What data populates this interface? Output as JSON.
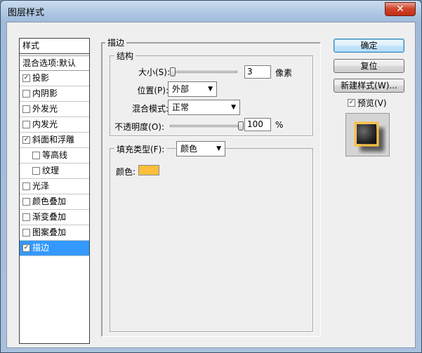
{
  "window": {
    "title": "图层样式",
    "close_label": "✕"
  },
  "left_panel": {
    "header": "样式",
    "blend_options": "混合选项:默认",
    "items": [
      {
        "label": "投影",
        "checked": true,
        "indent": false,
        "selected": false
      },
      {
        "label": "内阴影",
        "checked": false,
        "indent": false,
        "selected": false
      },
      {
        "label": "外发光",
        "checked": false,
        "indent": false,
        "selected": false
      },
      {
        "label": "内发光",
        "checked": false,
        "indent": false,
        "selected": false
      },
      {
        "label": "斜面和浮雕",
        "checked": true,
        "indent": false,
        "selected": false
      },
      {
        "label": "等高线",
        "checked": false,
        "indent": true,
        "selected": false
      },
      {
        "label": "纹理",
        "checked": false,
        "indent": true,
        "selected": false
      },
      {
        "label": "光泽",
        "checked": false,
        "indent": false,
        "selected": false
      },
      {
        "label": "颜色叠加",
        "checked": false,
        "indent": false,
        "selected": false
      },
      {
        "label": "渐变叠加",
        "checked": false,
        "indent": false,
        "selected": false
      },
      {
        "label": "图案叠加",
        "checked": false,
        "indent": false,
        "selected": false
      },
      {
        "label": "描边",
        "checked": true,
        "indent": false,
        "selected": true
      }
    ]
  },
  "stroke": {
    "group_title": "描边",
    "structure_title": "结构",
    "size_label": "大小(S):",
    "size_value": "3",
    "size_unit": "像素",
    "size_fraction": 0.0,
    "position_label": "位置(P):",
    "position_value": "外部",
    "blend_label": "混合模式:",
    "blend_value": "正常",
    "opacity_label": "不透明度(O):",
    "opacity_value": "100",
    "opacity_unit": "%",
    "opacity_fraction": 1.0,
    "fill_type_label": "填充类型(F):",
    "fill_type_value": "颜色",
    "color_label": "颜色:",
    "color_value": "#fcbf3c"
  },
  "buttons": {
    "ok": "确定",
    "reset": "复位",
    "new_style": "新建样式(W)...",
    "preview_label": "预览(V)",
    "preview_checked": true
  },
  "icons": {
    "checkmark": "✓",
    "dropdown": "▼"
  },
  "colors": {
    "selected_bg": "#3399ff",
    "swatch": "#fcbf3c"
  }
}
